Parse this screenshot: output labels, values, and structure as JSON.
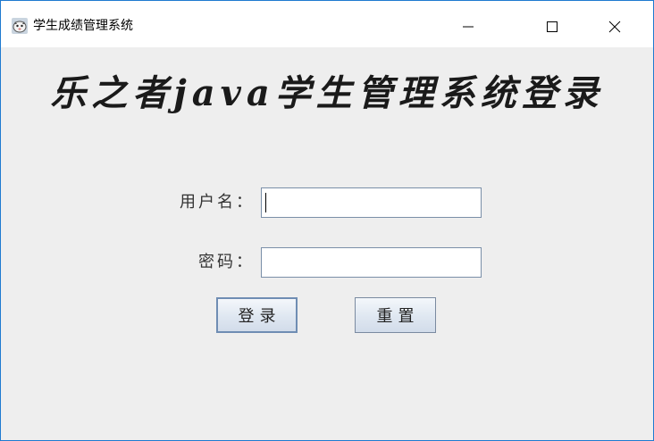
{
  "window": {
    "title": "学生成绩管理系统",
    "icon": "app-icon",
    "accent": "#1f7ad0"
  },
  "main": {
    "heading": "乐之者java学生管理系统登录",
    "username_label": "用户名：",
    "username_value": "",
    "password_label": "密码：",
    "password_value": "",
    "login_button": "登录",
    "reset_button": "重置"
  }
}
